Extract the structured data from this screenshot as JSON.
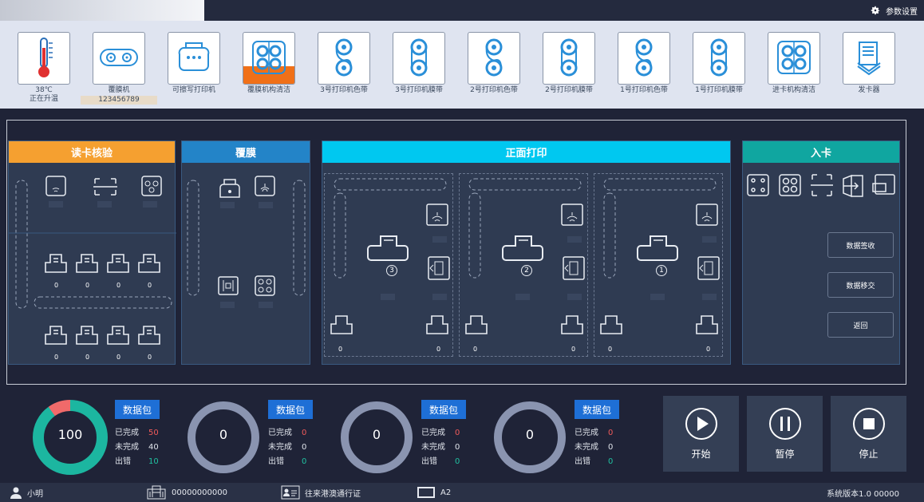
{
  "header": {
    "settings_label": "参数设置"
  },
  "toolbar": [
    {
      "label": "38℃",
      "sublabel": "正在升温",
      "icon": "thermometer-icon"
    },
    {
      "label": "覆膜机",
      "sublabel": "123456789",
      "icon": "laminator-icon"
    },
    {
      "label": "可擦写打印机",
      "icon": "printer-icon"
    },
    {
      "label": "覆膜机构清洁",
      "icon": "cleaning-icon",
      "level": 0.35
    },
    {
      "label": "3号打印机色带",
      "icon": "ribbon-icon"
    },
    {
      "label": "3号打印机膜带",
      "icon": "film-icon"
    },
    {
      "label": "2号打印机色带",
      "icon": "ribbon-icon"
    },
    {
      "label": "2号打印机膜带",
      "icon": "film-icon"
    },
    {
      "label": "1号打印机色带",
      "icon": "ribbon-icon"
    },
    {
      "label": "1号打印机膜带",
      "icon": "film-icon"
    },
    {
      "label": "进卡机构清洁",
      "icon": "cleaning-icon"
    },
    {
      "label": "发卡器",
      "icon": "card-stack-icon"
    }
  ],
  "panels": {
    "read": {
      "title": "读卡核验",
      "color": "#f5a030",
      "top_counts": [
        "0",
        "0",
        "0",
        "0"
      ],
      "bottom_counts": [
        "0",
        "0",
        "0",
        "0"
      ]
    },
    "laminate": {
      "title": "覆膜",
      "color": "#2384c8"
    },
    "print": {
      "title": "正面打印",
      "color": "#00c8f0",
      "printers": [
        {
          "num": "3",
          "count_left": "0",
          "count_right": "0"
        },
        {
          "num": "2",
          "count_left": "0",
          "count_right": "0"
        },
        {
          "num": "1",
          "count_left": "0",
          "count_right": "0"
        }
      ]
    },
    "entry": {
      "title": "入卡",
      "color": "#10a6a0",
      "buttons": [
        "数据签收",
        "数据移交",
        "返回"
      ]
    }
  },
  "gauges": [
    {
      "value": "100",
      "badge": "数据包",
      "completed_label": "已完成",
      "completed": "50",
      "pending_label": "未完成",
      "pending": "40",
      "error_label": "出错",
      "error": "10"
    },
    {
      "value": "0",
      "badge": "数据包",
      "completed_label": "已完成",
      "completed": "0",
      "pending_label": "未完成",
      "pending": "0",
      "error_label": "出错",
      "error": "0"
    },
    {
      "value": "0",
      "badge": "数据包",
      "completed_label": "已完成",
      "completed": "0",
      "pending_label": "未完成",
      "pending": "0",
      "error_label": "出错",
      "error": "0"
    },
    {
      "value": "0",
      "badge": "数据包",
      "completed_label": "已完成",
      "completed": "0",
      "pending_label": "未完成",
      "pending": "0",
      "error_label": "出错",
      "error": "0"
    }
  ],
  "controls": {
    "start": "开始",
    "pause": "暂停",
    "stop": "停止"
  },
  "status": {
    "user": "小明",
    "card_number": "00000000000",
    "document_type": "往来港澳通行证",
    "card_size": "A2",
    "version": "系统版本1.0 00000"
  },
  "colors": {
    "completed": "#f05a5a",
    "pending": "#dfe3ea",
    "error": "#20c0a0",
    "gauge_green": "#1cb6a0",
    "gauge_red": "#f06a6a"
  }
}
